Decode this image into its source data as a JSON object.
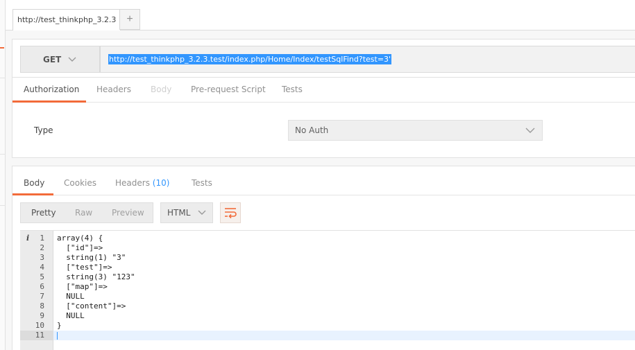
{
  "tabs": {
    "request_tab_title": "http://test_thinkphp_3.2.3",
    "new_tab_symbol": "+"
  },
  "request": {
    "method": "GET",
    "url": "http://test_thinkphp_3.2.3.test/index.php/Home/Index/testSqlFind?test=3'"
  },
  "request_tabs": [
    {
      "label": "Authorization",
      "state": "active"
    },
    {
      "label": "Headers",
      "state": "normal"
    },
    {
      "label": "Body",
      "state": "disabled"
    },
    {
      "label": "Pre-request Script",
      "state": "normal"
    },
    {
      "label": "Tests",
      "state": "normal"
    }
  ],
  "auth": {
    "type_label": "Type",
    "selected": "No Auth"
  },
  "response_tabs": {
    "body": "Body",
    "cookies": "Cookies",
    "headers": "Headers",
    "headers_count": "(10)",
    "tests": "Tests"
  },
  "view_modes": {
    "pretty": "Pretty",
    "raw": "Raw",
    "preview": "Preview"
  },
  "format": "HTML",
  "icons": {
    "info": "i",
    "chevron": "chevron-down-icon",
    "wrap": "wrap-lines-icon"
  },
  "colors": {
    "accent": "#f26b3a",
    "link": "#3296fe"
  },
  "code": {
    "current_line": 11,
    "lines": [
      {
        "n": "1",
        "text": "array(4) {"
      },
      {
        "n": "2",
        "text": "  [\"id\"]=>"
      },
      {
        "n": "3",
        "text": "  string(1) \"3\""
      },
      {
        "n": "4",
        "text": "  [\"test\"]=>"
      },
      {
        "n": "5",
        "text": "  string(3) \"123\""
      },
      {
        "n": "6",
        "text": "  [\"map\"]=>"
      },
      {
        "n": "7",
        "text": "  NULL"
      },
      {
        "n": "8",
        "text": "  [\"content\"]=>"
      },
      {
        "n": "9",
        "text": "  NULL"
      },
      {
        "n": "10",
        "text": "}"
      },
      {
        "n": "11",
        "text": ""
      }
    ]
  }
}
